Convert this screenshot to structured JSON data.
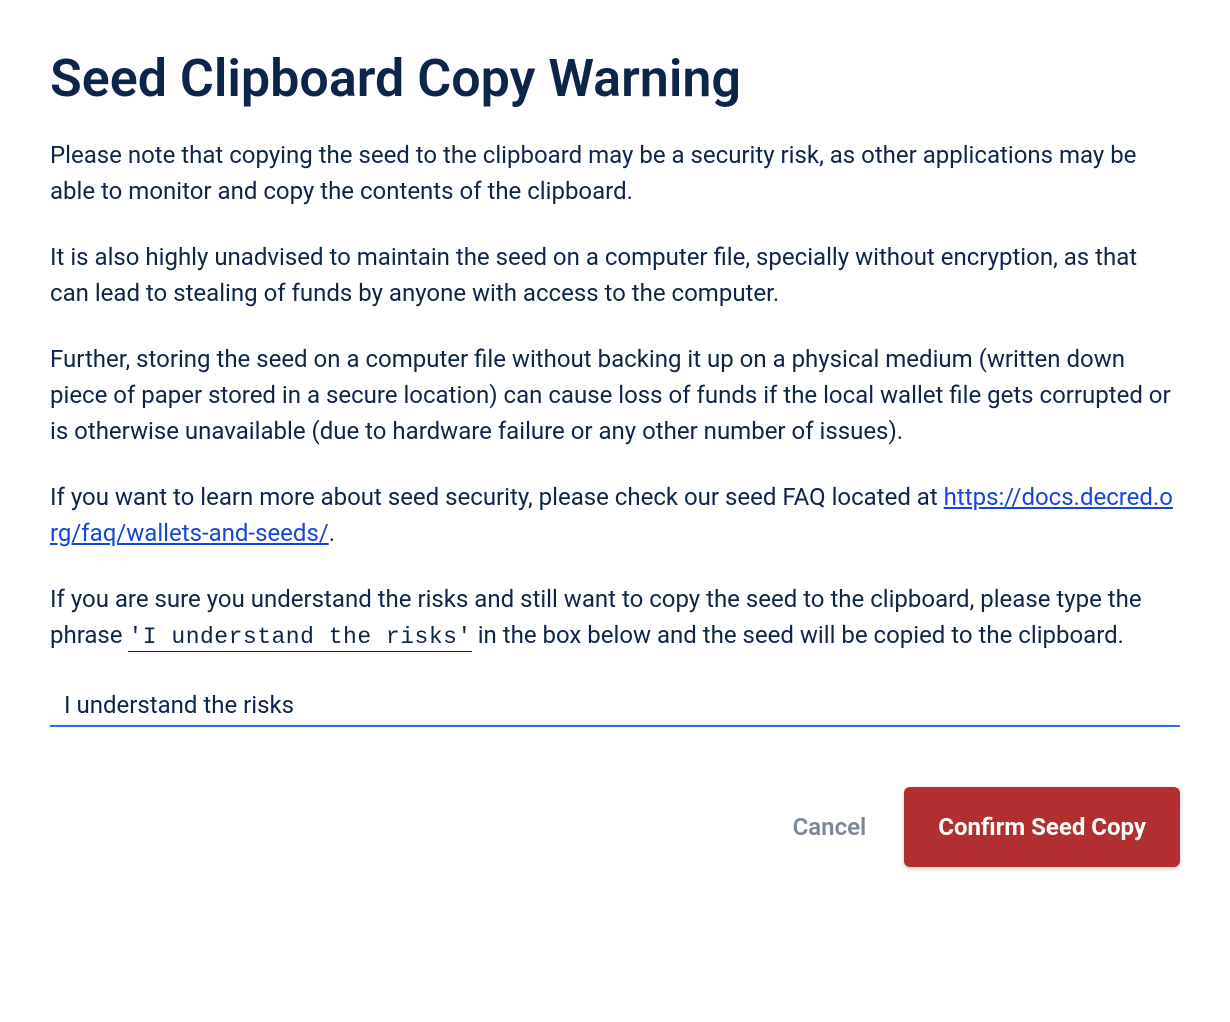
{
  "title": "Seed Clipboard Copy Warning",
  "paragraphs": {
    "p1": "Please note that copying the seed to the clipboard may be a security risk, as other applications may be able to monitor and copy the contents of the clipboard.",
    "p2": "It is also highly unadvised to maintain the seed on a computer file, specially without encryption, as that can lead to stealing of funds by anyone with access to the computer.",
    "p3": "Further, storing the seed on a computer file without backing it up on a physical medium (written down piece of paper stored in a secure location) can cause loss of funds if the local wallet file gets corrupted or is otherwise unavailable (due to hardware failure or any other number of issues).",
    "p4_prefix": "If you want to learn more about seed security, please check our seed FAQ located at ",
    "p4_link_text": "https://docs.decred.org/faq/wallets-and-seeds/",
    "p4_link_href": "https://docs.decred.org/faq/wallets-and-seeds/",
    "p4_suffix": ".",
    "p5_prefix": "If you are sure you understand the risks and still want to copy the seed to the clipboard, please type the phrase ",
    "p5_phrase": "'I understand the risks'",
    "p5_suffix": " in the box below and the seed will be copied to the clipboard."
  },
  "input": {
    "value": "I understand the risks",
    "placeholder": ""
  },
  "buttons": {
    "cancel": "Cancel",
    "confirm": "Confirm Seed Copy"
  }
}
